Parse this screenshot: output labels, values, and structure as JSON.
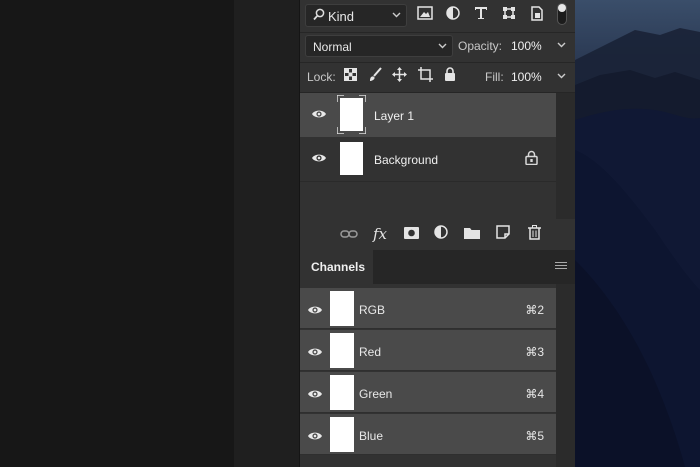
{
  "layers_panel": {
    "filter": {
      "search_icon": "search-icon",
      "kind_label": "Kind"
    },
    "filter_icons": [
      "image-filter-icon",
      "adjustment-filter-icon",
      "type-filter-icon",
      "shape-filter-icon",
      "smart-object-filter-icon"
    ],
    "blend_mode": "Normal",
    "opacity_label": "Opacity:",
    "opacity_value": "100%",
    "lock_label": "Lock:",
    "fill_label": "Fill:",
    "fill_value": "100%",
    "layers": [
      {
        "name": "Layer 1",
        "selected": true,
        "locked": false
      },
      {
        "name": "Background",
        "selected": false,
        "locked": true
      }
    ]
  },
  "channels_panel": {
    "tab_label": "Channels",
    "channels": [
      {
        "name": "RGB",
        "shortcut": "⌘2"
      },
      {
        "name": "Red",
        "shortcut": "⌘3"
      },
      {
        "name": "Green",
        "shortcut": "⌘4"
      },
      {
        "name": "Blue",
        "shortcut": "⌘5"
      }
    ]
  },
  "colors": {
    "panel_bg": "#323232",
    "selected_row": "#4a4a4a",
    "canvas_bg": "#171717"
  }
}
